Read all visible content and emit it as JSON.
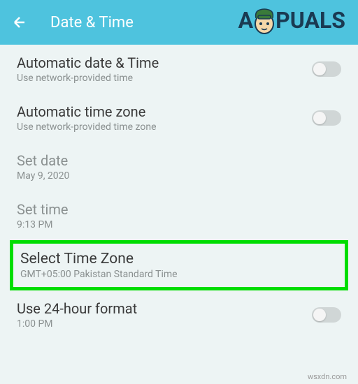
{
  "header": {
    "title": "Date & Time"
  },
  "watermark": {
    "text_left": "A",
    "text_right": "PUALS"
  },
  "settings": {
    "auto_date": {
      "title": "Automatic date & Time",
      "subtitle": "Use network-provided time"
    },
    "auto_zone": {
      "title": "Automatic time zone",
      "subtitle": "Use network-provided time zone"
    },
    "set_date": {
      "title": "Set date",
      "subtitle": "May 9, 2020"
    },
    "set_time": {
      "title": "Set time",
      "subtitle": "9:13 PM"
    },
    "select_zone": {
      "title": "Select Time Zone",
      "subtitle": "GMT+05:00 Pakistan Standard Time"
    },
    "use_24h": {
      "title": "Use 24-hour format",
      "subtitle": "1:00 PM"
    }
  },
  "footer": {
    "source": "wsxdn.com"
  }
}
